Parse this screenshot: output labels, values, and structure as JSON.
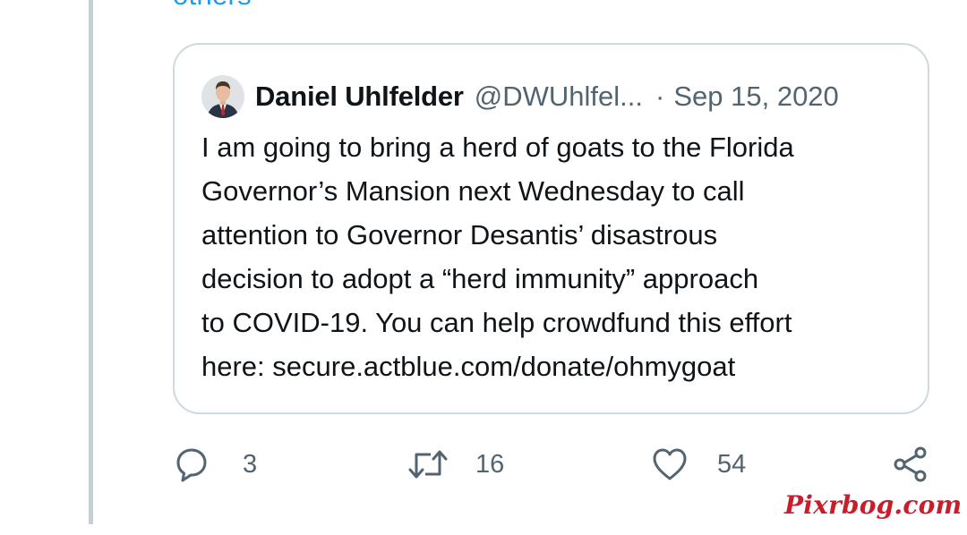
{
  "thread": {
    "cutoff_link_text": "others"
  },
  "quoted_tweet": {
    "author_name": "Daniel Uhlfelder",
    "author_handle": "@DWUhlfel...",
    "separator": "·",
    "date": "Sep 15, 2020",
    "body_lines": [
      "I am going to bring a herd of goats to the Florida",
      "Governor’s Mansion next Wednesday to call",
      "attention to Governor Desantis’ disastrous",
      "decision to adopt a “herd immunity” approach",
      "to COVID-19. You can help crowdfund this effort",
      "here:  secure.actblue.com/donate/ohmygoat"
    ]
  },
  "actions": {
    "reply": {
      "icon": "reply-icon",
      "count": "3"
    },
    "retweet": {
      "icon": "retweet-icon",
      "count": "16"
    },
    "like": {
      "icon": "heart-icon",
      "count": "54"
    },
    "share": {
      "icon": "share-icon"
    }
  },
  "watermark": "Pixrbog.com",
  "colors": {
    "text": "#0f1419",
    "secondary": "#536471",
    "border": "#cfd9de",
    "link": "#1d9bf0",
    "watermark": "#c81e2b"
  }
}
